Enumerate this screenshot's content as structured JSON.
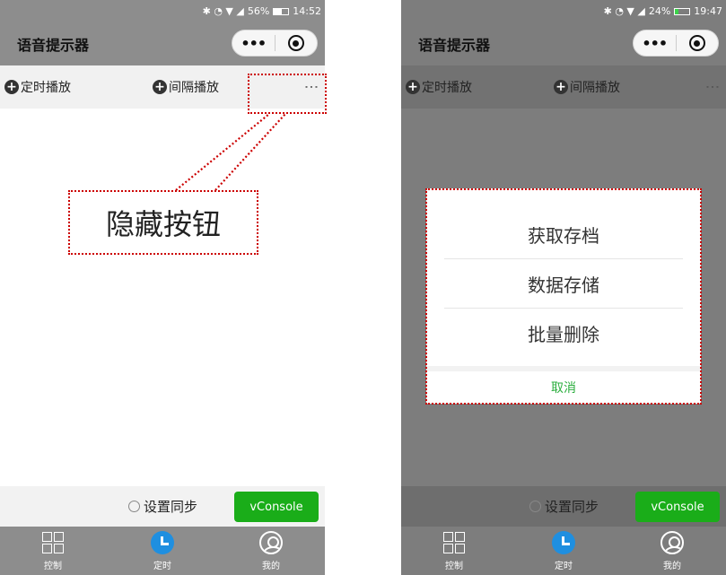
{
  "left": {
    "status": {
      "battery_pct": "56%",
      "time": "14:52",
      "battery_level": 0.56
    },
    "nav": {
      "title": "语音提示器",
      "more_glyph": "•••"
    },
    "toolbar": {
      "timed": "定时播放",
      "interval": "间隔播放",
      "more": "⋮"
    },
    "sync_bar": {
      "sync": "设置同步",
      "vconsole": "vConsole"
    },
    "tabs": [
      {
        "label": "控制",
        "icon": "grid-icon"
      },
      {
        "label": "定时",
        "icon": "clock-icon"
      },
      {
        "label": "我的",
        "icon": "user-icon"
      }
    ],
    "annotation": {
      "label": "隐藏按钮",
      "color": "#cc0000"
    }
  },
  "right": {
    "status": {
      "battery_pct": "24%",
      "time": "19:47",
      "battery_level": 0.24
    },
    "nav": {
      "title": "语音提示器",
      "more_glyph": "•••"
    },
    "toolbar": {
      "timed": "定时播放",
      "interval": "间隔播放",
      "more": "⋮"
    },
    "action_sheet": {
      "items": [
        "获取存档",
        "数据存储",
        "批量删除"
      ],
      "cancel": "取消",
      "cancel_color": "#2aae3d"
    },
    "sync_bar": {
      "sync": "设置同步",
      "vconsole": "vConsole"
    },
    "tabs": [
      {
        "label": "控制",
        "icon": "grid-icon"
      },
      {
        "label": "定时",
        "icon": "clock-icon"
      },
      {
        "label": "我的",
        "icon": "user-icon"
      }
    ]
  },
  "colors": {
    "accent_green": "#1aad19",
    "tab_active_blue": "#1f8fe0",
    "annotation_red": "#cc0000"
  }
}
